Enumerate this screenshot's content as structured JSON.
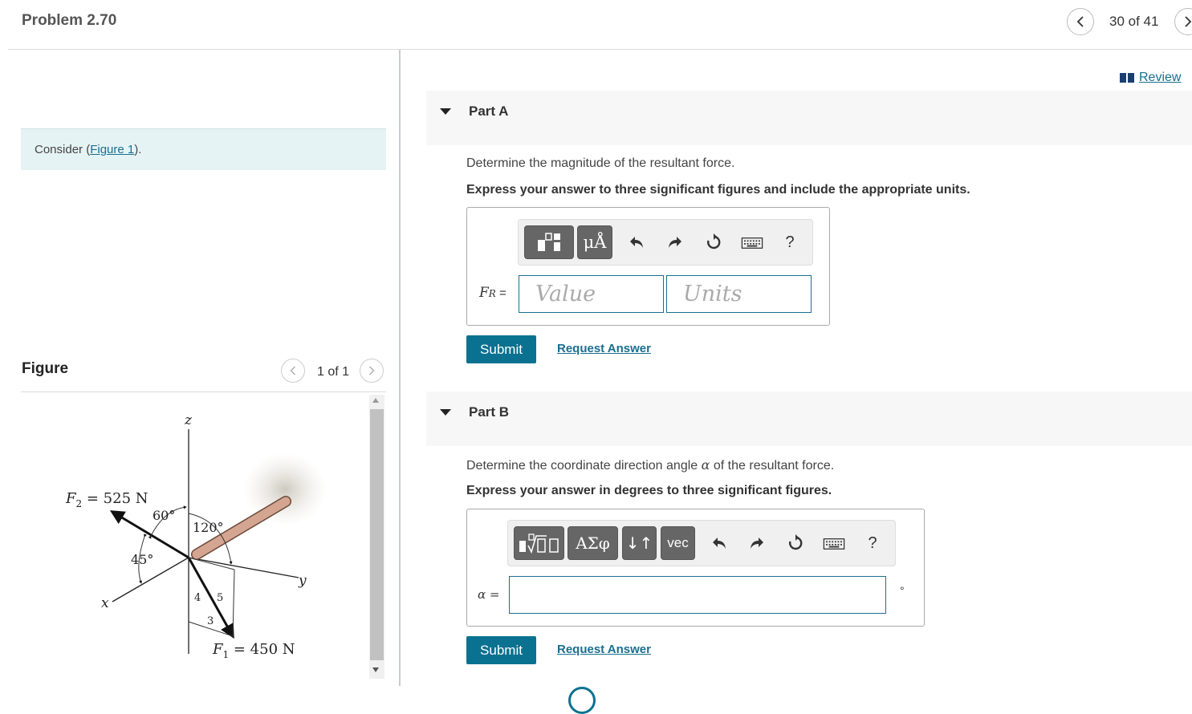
{
  "header": {
    "title": "Problem 2.70",
    "counter": "30 of 41"
  },
  "left": {
    "consider_prefix": "Consider (",
    "consider_link": "Figure 1",
    "consider_suffix": ").",
    "figure_label": "Figure",
    "figure_counter": "1 of 1",
    "figure": {
      "axis_z": "z",
      "axis_x": "x",
      "axis_y": "y",
      "f2_label": "F",
      "f2_sub": "2",
      "f2_value": " = 525 N",
      "f1_label": "F",
      "f1_sub": "1",
      "f1_value": " = 450 N",
      "angle_60": "60°",
      "angle_120": "120°",
      "angle_45": "45°",
      "tri_4": "4",
      "tri_5": "5",
      "tri_3": "3"
    }
  },
  "review": {
    "label": "Review"
  },
  "part_a": {
    "title": "Part A",
    "prompt": "Determine the magnitude of the resultant force.",
    "instruction": "Express your answer to three significant figures and include the appropriate units.",
    "toolbar": {
      "units_btn": "μÅ",
      "help": "?"
    },
    "label_main": "F",
    "label_sub": "R",
    "label_eq": " =",
    "value_placeholder": "Value",
    "units_placeholder": "Units",
    "submit": "Submit",
    "request": "Request Answer"
  },
  "part_b": {
    "title": "Part B",
    "prompt_pre": "Determine the coordinate direction angle ",
    "prompt_sym": "α",
    "prompt_post": " of the resultant force.",
    "instruction": "Express your answer in degrees to three significant figures.",
    "toolbar": {
      "greek_btn": "ΑΣφ",
      "arrows_btn": "↓↑",
      "vec_btn": "vec",
      "help": "?"
    },
    "label": "α =",
    "unit": "°",
    "submit": "Submit",
    "request": "Request Answer"
  }
}
